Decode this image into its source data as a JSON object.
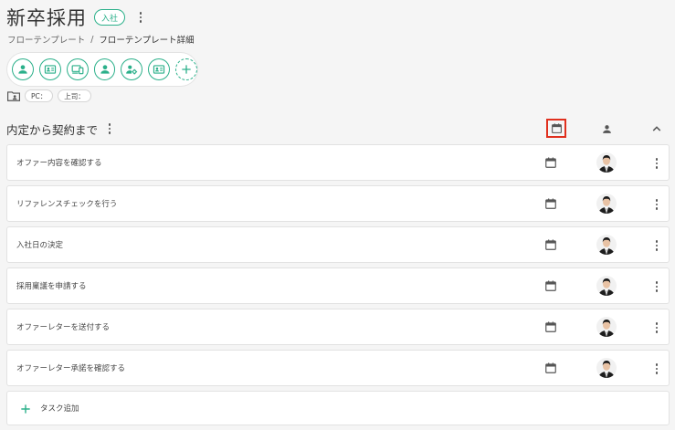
{
  "header": {
    "title": "新卒採用",
    "badge": "入社"
  },
  "breadcrumb": {
    "parent": "フローテンプレート",
    "separator": "/",
    "current": "フローテンプレート詳細"
  },
  "toolbar": {
    "icons": [
      "person-icon",
      "id-card-icon",
      "devices-icon",
      "person-icon",
      "settings-icon",
      "id-card-icon"
    ],
    "add_icon": "plus-icon"
  },
  "meta": {
    "icon": "folder-user-icon",
    "chips": [
      "PC：",
      "上司："
    ]
  },
  "section": {
    "title": "内定から契約まで"
  },
  "tasks": [
    {
      "label": "オファー内容を確認する"
    },
    {
      "label": "リファレンスチェックを行う"
    },
    {
      "label": "入社日の決定"
    },
    {
      "label": "採用稟議を申請する"
    },
    {
      "label": "オファーレターを送付する"
    },
    {
      "label": "オファーレター承諾を確認する"
    }
  ],
  "add_task": {
    "label": "タスク追加"
  },
  "colors": {
    "accent": "#2bb08a",
    "highlight": "#e0301e",
    "background": "#f5f5f5"
  }
}
